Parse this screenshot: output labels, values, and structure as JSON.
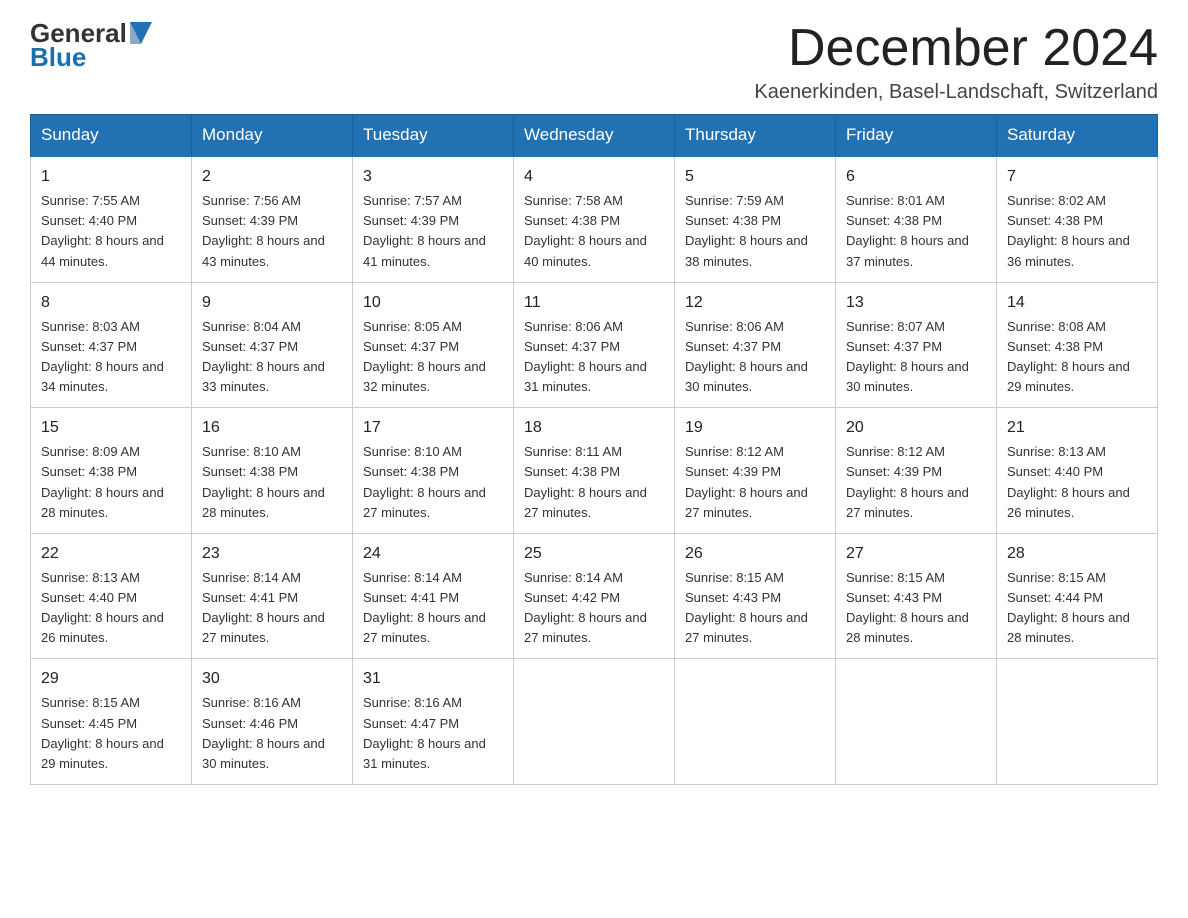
{
  "header": {
    "logo_general": "General",
    "logo_blue": "Blue",
    "month_title": "December 2024",
    "subtitle": "Kaenerkinden, Basel-Landschaft, Switzerland"
  },
  "days_of_week": [
    "Sunday",
    "Monday",
    "Tuesday",
    "Wednesday",
    "Thursday",
    "Friday",
    "Saturday"
  ],
  "weeks": [
    [
      {
        "day": "1",
        "sunrise": "7:55 AM",
        "sunset": "4:40 PM",
        "daylight": "8 hours and 44 minutes."
      },
      {
        "day": "2",
        "sunrise": "7:56 AM",
        "sunset": "4:39 PM",
        "daylight": "8 hours and 43 minutes."
      },
      {
        "day": "3",
        "sunrise": "7:57 AM",
        "sunset": "4:39 PM",
        "daylight": "8 hours and 41 minutes."
      },
      {
        "day": "4",
        "sunrise": "7:58 AM",
        "sunset": "4:38 PM",
        "daylight": "8 hours and 40 minutes."
      },
      {
        "day": "5",
        "sunrise": "7:59 AM",
        "sunset": "4:38 PM",
        "daylight": "8 hours and 38 minutes."
      },
      {
        "day": "6",
        "sunrise": "8:01 AM",
        "sunset": "4:38 PM",
        "daylight": "8 hours and 37 minutes."
      },
      {
        "day": "7",
        "sunrise": "8:02 AM",
        "sunset": "4:38 PM",
        "daylight": "8 hours and 36 minutes."
      }
    ],
    [
      {
        "day": "8",
        "sunrise": "8:03 AM",
        "sunset": "4:37 PM",
        "daylight": "8 hours and 34 minutes."
      },
      {
        "day": "9",
        "sunrise": "8:04 AM",
        "sunset": "4:37 PM",
        "daylight": "8 hours and 33 minutes."
      },
      {
        "day": "10",
        "sunrise": "8:05 AM",
        "sunset": "4:37 PM",
        "daylight": "8 hours and 32 minutes."
      },
      {
        "day": "11",
        "sunrise": "8:06 AM",
        "sunset": "4:37 PM",
        "daylight": "8 hours and 31 minutes."
      },
      {
        "day": "12",
        "sunrise": "8:06 AM",
        "sunset": "4:37 PM",
        "daylight": "8 hours and 30 minutes."
      },
      {
        "day": "13",
        "sunrise": "8:07 AM",
        "sunset": "4:37 PM",
        "daylight": "8 hours and 30 minutes."
      },
      {
        "day": "14",
        "sunrise": "8:08 AM",
        "sunset": "4:38 PM",
        "daylight": "8 hours and 29 minutes."
      }
    ],
    [
      {
        "day": "15",
        "sunrise": "8:09 AM",
        "sunset": "4:38 PM",
        "daylight": "8 hours and 28 minutes."
      },
      {
        "day": "16",
        "sunrise": "8:10 AM",
        "sunset": "4:38 PM",
        "daylight": "8 hours and 28 minutes."
      },
      {
        "day": "17",
        "sunrise": "8:10 AM",
        "sunset": "4:38 PM",
        "daylight": "8 hours and 27 minutes."
      },
      {
        "day": "18",
        "sunrise": "8:11 AM",
        "sunset": "4:38 PM",
        "daylight": "8 hours and 27 minutes."
      },
      {
        "day": "19",
        "sunrise": "8:12 AM",
        "sunset": "4:39 PM",
        "daylight": "8 hours and 27 minutes."
      },
      {
        "day": "20",
        "sunrise": "8:12 AM",
        "sunset": "4:39 PM",
        "daylight": "8 hours and 27 minutes."
      },
      {
        "day": "21",
        "sunrise": "8:13 AM",
        "sunset": "4:40 PM",
        "daylight": "8 hours and 26 minutes."
      }
    ],
    [
      {
        "day": "22",
        "sunrise": "8:13 AM",
        "sunset": "4:40 PM",
        "daylight": "8 hours and 26 minutes."
      },
      {
        "day": "23",
        "sunrise": "8:14 AM",
        "sunset": "4:41 PM",
        "daylight": "8 hours and 27 minutes."
      },
      {
        "day": "24",
        "sunrise": "8:14 AM",
        "sunset": "4:41 PM",
        "daylight": "8 hours and 27 minutes."
      },
      {
        "day": "25",
        "sunrise": "8:14 AM",
        "sunset": "4:42 PM",
        "daylight": "8 hours and 27 minutes."
      },
      {
        "day": "26",
        "sunrise": "8:15 AM",
        "sunset": "4:43 PM",
        "daylight": "8 hours and 27 minutes."
      },
      {
        "day": "27",
        "sunrise": "8:15 AM",
        "sunset": "4:43 PM",
        "daylight": "8 hours and 28 minutes."
      },
      {
        "day": "28",
        "sunrise": "8:15 AM",
        "sunset": "4:44 PM",
        "daylight": "8 hours and 28 minutes."
      }
    ],
    [
      {
        "day": "29",
        "sunrise": "8:15 AM",
        "sunset": "4:45 PM",
        "daylight": "8 hours and 29 minutes."
      },
      {
        "day": "30",
        "sunrise": "8:16 AM",
        "sunset": "4:46 PM",
        "daylight": "8 hours and 30 minutes."
      },
      {
        "day": "31",
        "sunrise": "8:16 AM",
        "sunset": "4:47 PM",
        "daylight": "8 hours and 31 minutes."
      },
      null,
      null,
      null,
      null
    ]
  ]
}
